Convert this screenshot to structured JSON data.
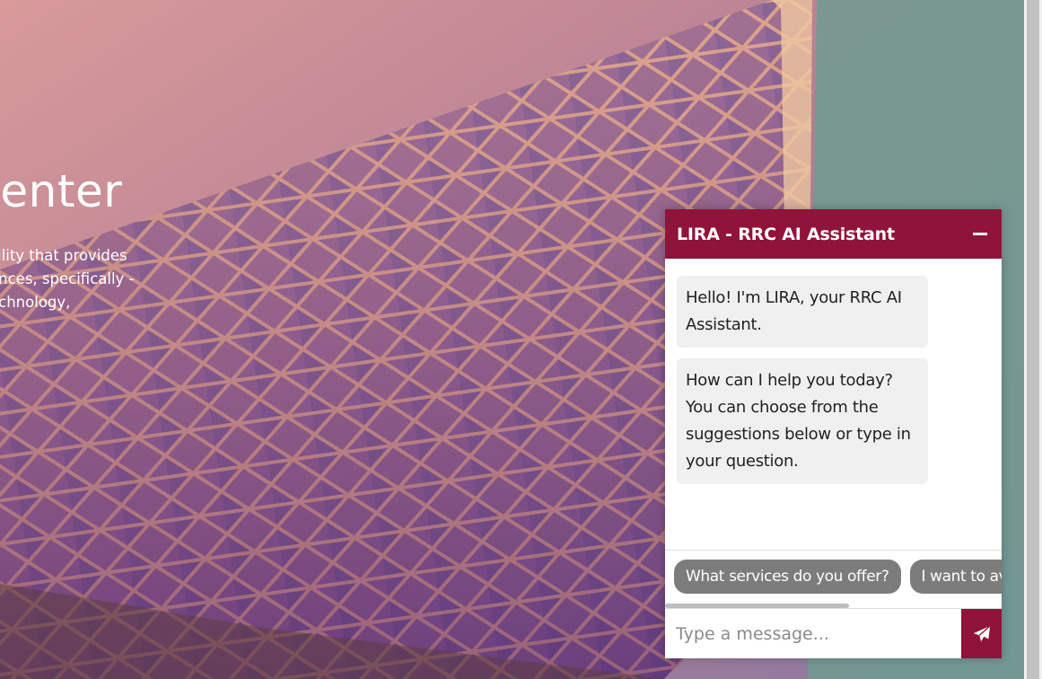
{
  "hero": {
    "title": "Center",
    "desc_lines": [
      "cility that provides",
      "ences, specifically -",
      "echnology,"
    ]
  },
  "chat": {
    "title": "LIRA - RRC AI Assistant",
    "minimize_icon": "minus-icon",
    "send_icon": "paper-plane-icon",
    "messages": [
      "Hello! I'm LIRA, your RRC AI Assistant.",
      "How can I help you today? You can choose from the suggestions below or type in your question."
    ],
    "suggestions": [
      "What services do you offer?",
      "I want to avail"
    ],
    "input_placeholder": "Type a message...",
    "colors": {
      "header": "#8f1439",
      "chip": "#7c7c7c"
    }
  }
}
